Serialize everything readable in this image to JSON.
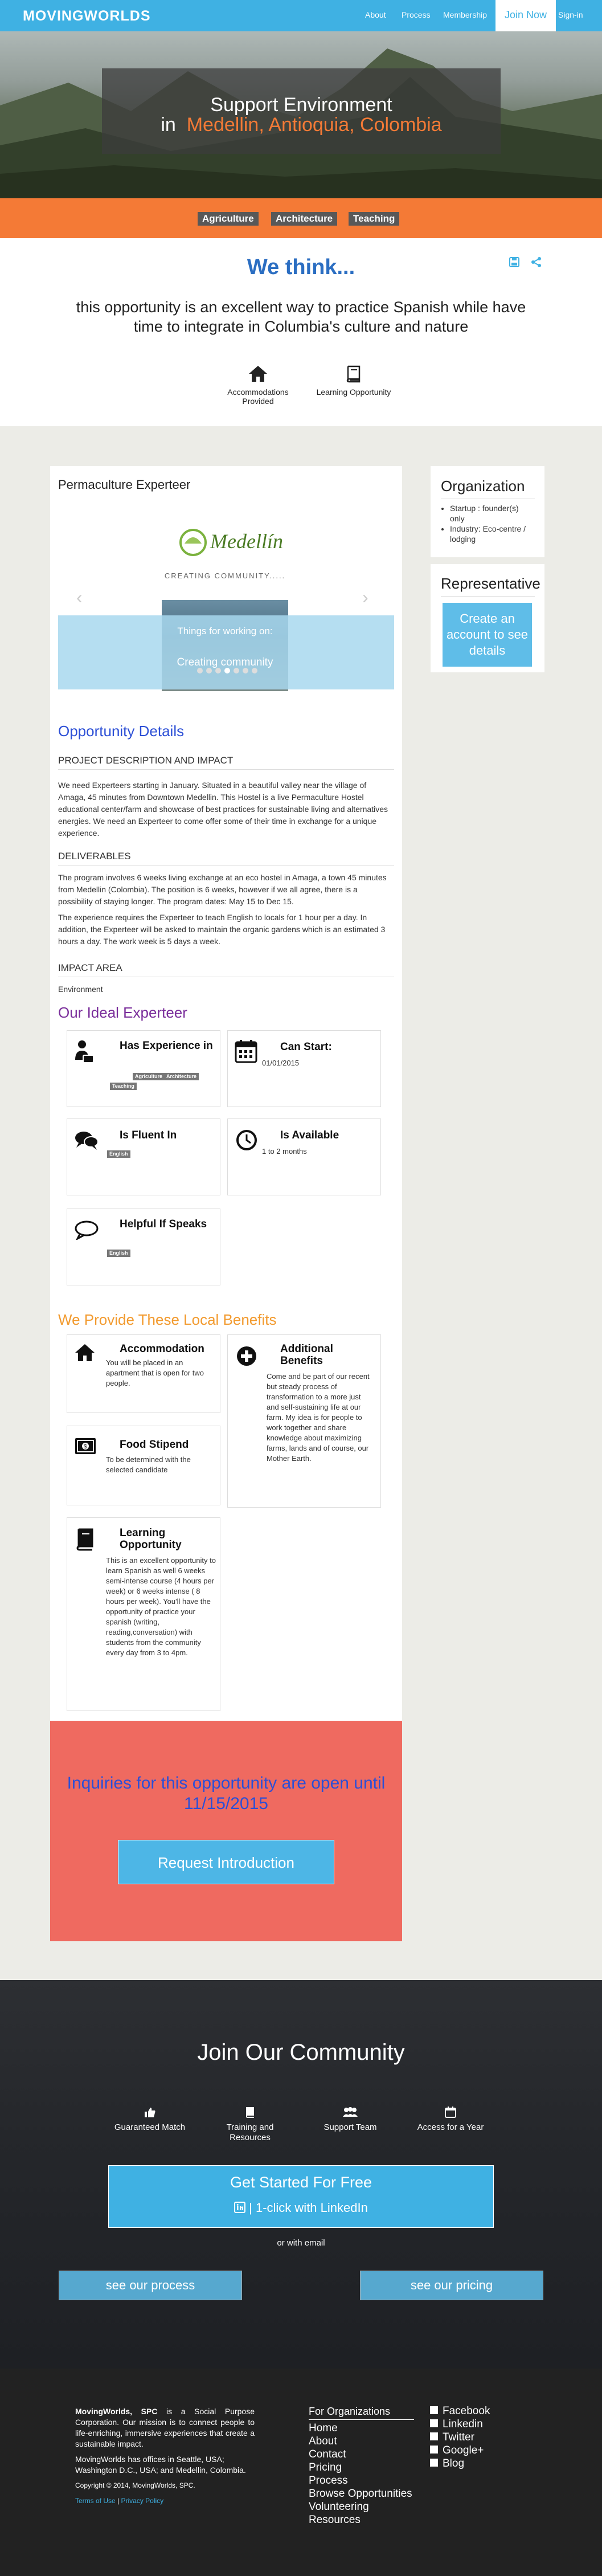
{
  "nav": {
    "logo": "MOVINGWORLDS",
    "links": [
      "About",
      "Process",
      "Membership"
    ],
    "join": "Join Now",
    "signin": "Sign-in"
  },
  "hero": {
    "title": "Support Environment",
    "in": "in",
    "location": "Medellin, Antioquia, Colombia"
  },
  "tags": [
    "Agriculture",
    "Architecture",
    "Teaching"
  ],
  "think": {
    "heading": "We think...",
    "text": "this opportunity is an excellent way to practice Spanish while have time to integrate in Columbia's culture and nature",
    "perks": [
      "Accommodations Provided",
      "Learning Opportunity"
    ]
  },
  "post": {
    "title": "Permaculture Experteer",
    "slide": {
      "logo_text": "Medellín",
      "caption": "CREATING COMMUNITY.....",
      "photo_text_1": "Things for working on:",
      "photo_text_2": "Creating community"
    },
    "details_heading": "Opportunity Details",
    "sections": [
      {
        "title": "PROJECT DESCRIPTION AND IMPACT",
        "text": "We need Experteers starting in January.  Situated in a beautiful valley near the village of Amaga, 45 minutes from Downtown Medellin. This Hostel is a live Permaculture Hostel educational center/farm and showcase of best practices for sustainable living and alternatives energies.  We need an Experteer to come offer some of their time in exchange for a unique experience."
      },
      {
        "title": "DELIVERABLES",
        "text": "The program involves 6 weeks living exchange at an eco hostel in Amaga, a town 45 minutes from Medellin (Colombia). The position is 6 weeks, however if we all agree, there is a possibility of staying longer.  The program dates: May 15 to Dec 15.",
        "text2": "The experience requires the Experteer to teach English to locals for 1 hour per a day.  In addition, the Experteer will be asked to maintain the organic gardens which is an estimated 3 hours a day.  The work week is 5 days a week."
      },
      {
        "title": "IMPACT AREA",
        "text": "Environment"
      }
    ]
  },
  "ideal": {
    "heading": "Our Ideal Experteer",
    "cards": [
      {
        "title": "Has Experience in",
        "pills": [
          "Agriculture",
          "Architecture",
          "Teaching"
        ],
        "icon": "person-briefcase-icon"
      },
      {
        "title": "Can Start:",
        "text": "01/01/2015",
        "icon": "calendar-icon"
      },
      {
        "title": "Is Fluent In",
        "pills": [
          "English"
        ],
        "icon": "speech-bubbles-icon"
      },
      {
        "title": "Is Available",
        "text": "1 to 2 months",
        "icon": "clock-icon"
      },
      {
        "title": "Helpful If Speaks",
        "pills": [
          "English"
        ],
        "icon": "speech-bubble-icon"
      }
    ]
  },
  "benefits": {
    "heading": "We Provide These Local Benefits",
    "cards": [
      {
        "title": "Accommodation",
        "text": "You will be placed in an apartment that is open for two people.",
        "icon": "home-icon"
      },
      {
        "title": "Additional Benefits",
        "text": "Come and be part of our recent but steady process of transformation to a more just and self-sustaining life at our farm. My idea is for people to work together and share knowledge about maximizing farms, lands and of course, our Mother Earth.",
        "icon": "plus-circle-icon"
      },
      {
        "title": "Food Stipend",
        "text": "To be determined with the selected candidate",
        "icon": "money-icon"
      },
      {
        "title": "Learning Opportunity",
        "text": "This is an excellent opportunity to learn Spanish as well 6 weeks semi-intense course (4 hours per week) or 6 weeks intense ( 8 hours per week). You'll have the opportunity of practice your spanish (writing, reading,conversation) with students from the community every day from 3 to 4pm.",
        "icon": "book-icon"
      }
    ]
  },
  "inquiry": {
    "text": "Inquiries for this opportunity are open until 11/15/2015",
    "button": "Request Introduction"
  },
  "sidebar": {
    "org_title": "Organization",
    "org_items": [
      "Startup : founder(s) only",
      "Industry: Eco-centre / lodging"
    ],
    "rep_title": "Representative",
    "rep_button": "Create an account to see details"
  },
  "community": {
    "title": "Join Our Community",
    "perks": [
      "Guaranteed Match",
      "Training and Resources",
      "Support Team",
      "Access for a Year"
    ],
    "start": "Get Started For Free",
    "linkedin": "1-click with LinkedIn",
    "or_email": "or with email",
    "process_btn": "see our process",
    "pricing_btn": "see our pricing"
  },
  "footer": {
    "about_brand": "MovingWorlds, SPC",
    "about_text": " is a Social Purpose Corporation. Our mission is to connect people to life-enriching, immersive experiences that create a sustainable impact.",
    "offices": "MovingWorlds has offices in Seattle, USA; Washington D.C., USA; and Medellin, Colombia.",
    "copyright": "Copyright © 2014, MovingWorlds, SPC.",
    "terms": "Terms of Use",
    "sep": " | ",
    "privacy": "Privacy Policy",
    "org_heading": "For Organizations",
    "links": [
      "Home",
      "About",
      "Contact",
      "Pricing",
      "Process",
      "Browse Opportunities",
      "Volunteering",
      "Resources"
    ],
    "social": [
      "Facebook",
      "Linkedin",
      "Twitter",
      "Google+",
      "Blog"
    ]
  }
}
